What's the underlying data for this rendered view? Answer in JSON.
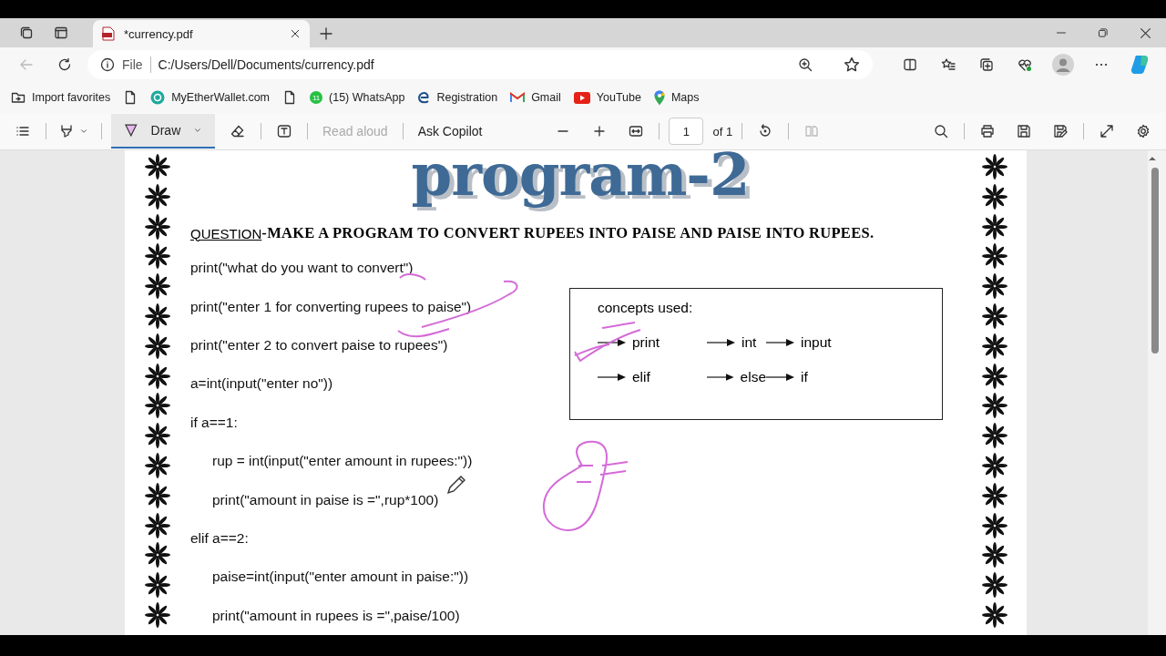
{
  "window": {
    "tabs": [
      {
        "title": "*currency.pdf",
        "selected": true
      }
    ]
  },
  "address_bar": {
    "scheme": "File",
    "url": "C:/Users/Dell/Documents/currency.pdf"
  },
  "bookmarks": [
    {
      "kind": "import",
      "label": "Import favorites"
    },
    {
      "kind": "page"
    },
    {
      "kind": "wallet",
      "label": "MyEtherWallet.com"
    },
    {
      "kind": "page"
    },
    {
      "kind": "whatsapp",
      "badge": "11",
      "label": "(15) WhatsApp"
    },
    {
      "kind": "edge",
      "label": "Registration"
    },
    {
      "kind": "gmail",
      "label": "Gmail"
    },
    {
      "kind": "youtube",
      "label": "YouTube"
    },
    {
      "kind": "maps",
      "label": "Maps"
    }
  ],
  "pdf_toolbar": {
    "draw": {
      "label": "Draw",
      "selected": true
    },
    "read_aloud": {
      "label": "Read aloud",
      "disabled": true
    },
    "ask_copilot": {
      "label": "Ask Copilot"
    },
    "page_number": "1",
    "page_total": "of 1"
  },
  "document": {
    "title": "program-2",
    "question": {
      "label": "QUESTION",
      "text": "-MAKE A PROGRAM TO CONVERT RUPEES INTO PAISE AND PAISE INTO RUPEES."
    },
    "code_lines": [
      {
        "text": "print(\"what do you want to convert\")"
      },
      {
        "text": "print(\"enter 1 for converting rupees to paise\")"
      },
      {
        "text": "print(\"enter 2 to convert paise to rupees\")"
      },
      {
        "text": "a=int(input(\"enter no\"))"
      },
      {
        "text": "if a==1:",
        "children": [
          {
            "text": "rup = int(input(\"enter amount in rupees:\"))"
          },
          {
            "text": "print(\"amount in paise is =\",rup*100)"
          }
        ]
      },
      {
        "text": "elif a==2:",
        "children": [
          {
            "text": "paise=int(input(\"enter amount in paise:\"))"
          },
          {
            "text": "print(\"amount in rupees is =\",paise/100)"
          }
        ]
      }
    ],
    "concepts": {
      "title": "concepts used:",
      "items": [
        "print",
        "int",
        "input",
        "elif",
        "else",
        "if"
      ]
    }
  }
}
